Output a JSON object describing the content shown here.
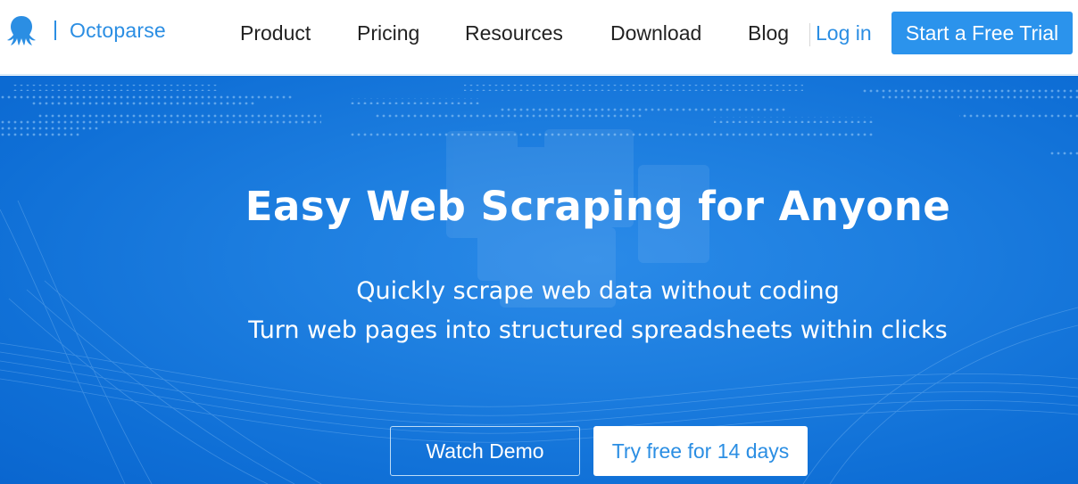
{
  "brand": {
    "name": "Octoparse",
    "icon": "octopus-logo-icon",
    "color": "#2b8ee3"
  },
  "nav": {
    "items": [
      {
        "label": "Product"
      },
      {
        "label": "Pricing"
      },
      {
        "label": "Resources"
      },
      {
        "label": "Download"
      },
      {
        "label": "Blog"
      }
    ],
    "login_label": "Log in",
    "cta_label": "Start a Free Trial"
  },
  "hero": {
    "title": "Easy Web Scraping for Anyone",
    "subtitle_line1": "Quickly scrape web data without coding",
    "subtitle_line2": "Turn web pages into structured spreadsheets within clicks",
    "watch_demo_label": "Watch Demo",
    "try_free_label": "Try free for 14 days",
    "background_color": "#1a7ae0"
  }
}
